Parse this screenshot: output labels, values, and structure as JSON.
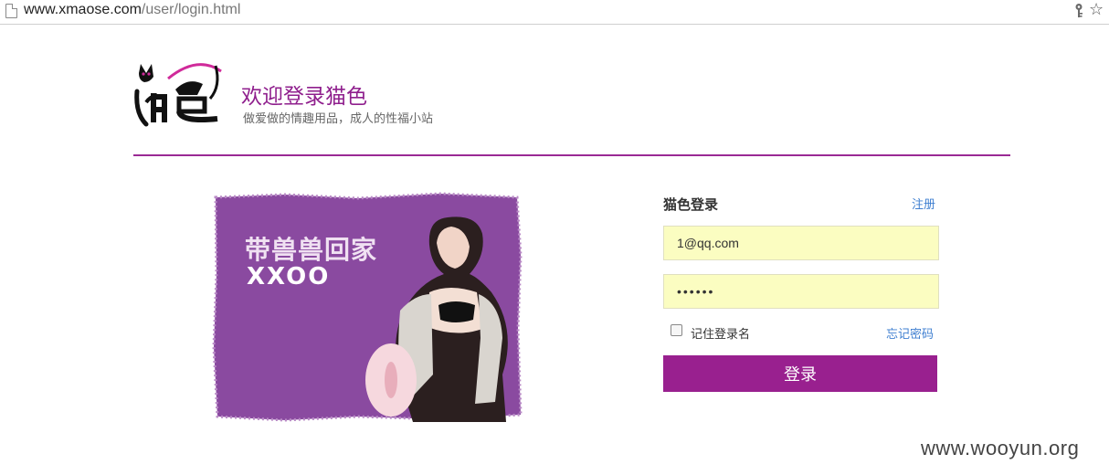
{
  "browser": {
    "url_host": "www.xmaose.com",
    "url_path": "/user/login.html",
    "star_icon": "star-outline-icon",
    "key_icon": "key-icon"
  },
  "header": {
    "logo_text": "猫色",
    "title": "欢迎登录猫色",
    "slogan": "做爱做的情趣用品，成人的性福小站",
    "accent_color": "#9a2a94"
  },
  "banner": {
    "line1": "带兽兽回家",
    "line2": "XXOO",
    "background_color": "#8a4aa0"
  },
  "login_form": {
    "title": "猫色登录",
    "register_link": "注册",
    "username_value": "1@qq.com",
    "password_value": "••••••",
    "remember_label": "记住登录名",
    "remember_checked": false,
    "forgot_link": "忘记密码",
    "submit_label": "登录",
    "button_color": "#99208f",
    "input_bg_color": "#fbfdc1",
    "link_color": "#3f7fd0"
  },
  "watermark": "www.wooyun.org"
}
